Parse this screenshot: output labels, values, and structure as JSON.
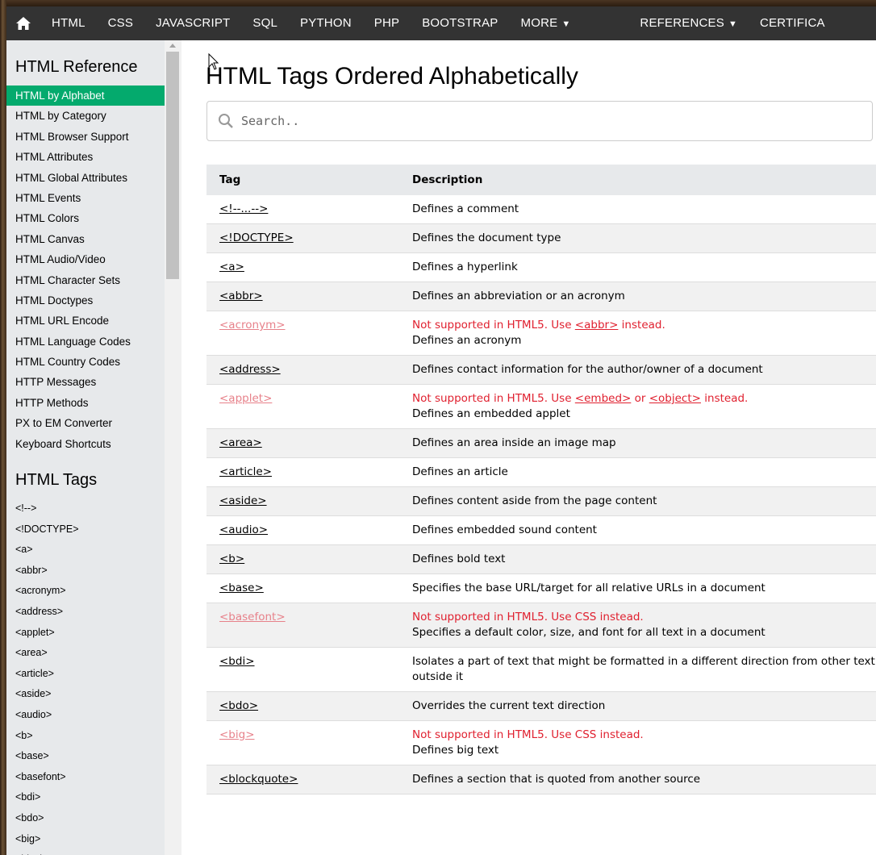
{
  "topnav": {
    "home_icon": "home-icon",
    "links": [
      "HTML",
      "CSS",
      "JAVASCRIPT",
      "SQL",
      "PYTHON",
      "PHP",
      "BOOTSTRAP"
    ],
    "more_label": "MORE",
    "references_label": "REFERENCES",
    "certificates_label": "CERTIFICA"
  },
  "sidebar": {
    "reference_heading": "HTML Reference",
    "reference_items": [
      "HTML by Alphabet",
      "HTML by Category",
      "HTML Browser Support",
      "HTML Attributes",
      "HTML Global Attributes",
      "HTML Events",
      "HTML Colors",
      "HTML Canvas",
      "HTML Audio/Video",
      "HTML Character Sets",
      "HTML Doctypes",
      "HTML URL Encode",
      "HTML Language Codes",
      "HTML Country Codes",
      "HTTP Messages",
      "HTTP Methods",
      "PX to EM Converter",
      "Keyboard Shortcuts"
    ],
    "active_index": 0,
    "active_color": "#04aa6d",
    "tags_heading": "HTML Tags",
    "tag_items": [
      "<!-->",
      "<!DOCTYPE>",
      "<a>",
      "<abbr>",
      "<acronym>",
      "<address>",
      "<applet>",
      "<area>",
      "<article>",
      "<aside>",
      "<audio>",
      "<b>",
      "<base>",
      "<basefont>",
      "<bdi>",
      "<bdo>",
      "<big>",
      "<blockquote>"
    ]
  },
  "main": {
    "title": "HTML Tags Ordered Alphabetically",
    "search_placeholder": "Search..",
    "table": {
      "headers": [
        "Tag",
        "Description"
      ],
      "rows": [
        {
          "tag": "<!--...-->",
          "desc": "Defines a comment"
        },
        {
          "tag": "<!DOCTYPE>",
          "desc": "Defines the document type"
        },
        {
          "tag": "<a>",
          "desc": "Defines a hyperlink"
        },
        {
          "tag": "<abbr>",
          "desc": "Defines an abbreviation or an acronym"
        },
        {
          "tag": "<acronym>",
          "deprecated": true,
          "note_parts": [
            "Not supported in HTML5. Use ",
            "<abbr>",
            " instead."
          ],
          "desc": "Defines an acronym"
        },
        {
          "tag": "<address>",
          "desc": "Defines contact information for the author/owner of a document"
        },
        {
          "tag": "<applet>",
          "deprecated": true,
          "note_parts": [
            "Not supported in HTML5. Use ",
            "<embed>",
            " or ",
            "<object>",
            " instead."
          ],
          "desc": "Defines an embedded applet"
        },
        {
          "tag": "<area>",
          "desc": "Defines an area inside an image map"
        },
        {
          "tag": "<article>",
          "desc": "Defines an article"
        },
        {
          "tag": "<aside>",
          "desc": "Defines content aside from the page content"
        },
        {
          "tag": "<audio>",
          "desc": "Defines embedded sound content"
        },
        {
          "tag": "<b>",
          "desc": "Defines bold text"
        },
        {
          "tag": "<base>",
          "desc": "Specifies the base URL/target for all relative URLs in a document"
        },
        {
          "tag": "<basefont>",
          "deprecated": true,
          "note_parts": [
            "Not supported in HTML5. Use CSS instead."
          ],
          "desc": "Specifies a default color, size, and font for all text in a document"
        },
        {
          "tag": "<bdi>",
          "desc": "Isolates a part of text that might be formatted in a different direction from other text outside it"
        },
        {
          "tag": "<bdo>",
          "desc": "Overrides the current text direction"
        },
        {
          "tag": "<big>",
          "deprecated": true,
          "note_parts": [
            "Not supported in HTML5. Use CSS instead."
          ],
          "desc": "Defines big text"
        },
        {
          "tag": "<blockquote>",
          "desc": "Defines a section that is quoted from another source"
        }
      ]
    }
  },
  "colors": {
    "topnav_bg": "#333333",
    "sidebar_bg": "#e7e9eb",
    "deprecated_tag": "#e7818a",
    "deprecated_note": "#e0202f"
  }
}
